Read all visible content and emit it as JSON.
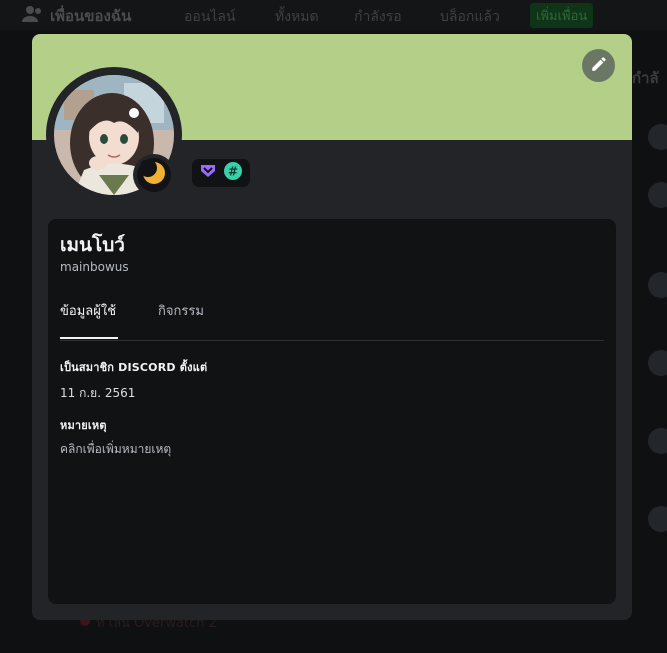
{
  "background": {
    "title": "เพื่อนของฉัน",
    "tabs": [
      "ออนไลน์",
      "ทั้งหมด",
      "กำลังรอ",
      "บล็อกแล้ว"
    ],
    "add_friend": "เพิ่มเพื่อน",
    "right_label": "กำลั",
    "bottom_text": "ที่ เล่น Overwatch 2"
  },
  "profile": {
    "banner_color": "#b3cf88",
    "display_name": "เมนโบว์",
    "username": "mainbowus",
    "status": "idle",
    "edit_icon": "pencil-icon",
    "badges": [
      "nitro-badge-icon",
      "hashtag-badge-icon"
    ]
  },
  "tabs": {
    "user_info": "ข้อมูลผู้ใช้",
    "activity": "กิจกรรม"
  },
  "member_since": {
    "heading": "เป็นสมาชิก DISCORD ตั้งแต่",
    "date": "11 ก.ย. 2561"
  },
  "note": {
    "heading": "หมายเหตุ",
    "placeholder": "คลิกเพื่อเพิ่มหมายเหตุ"
  }
}
